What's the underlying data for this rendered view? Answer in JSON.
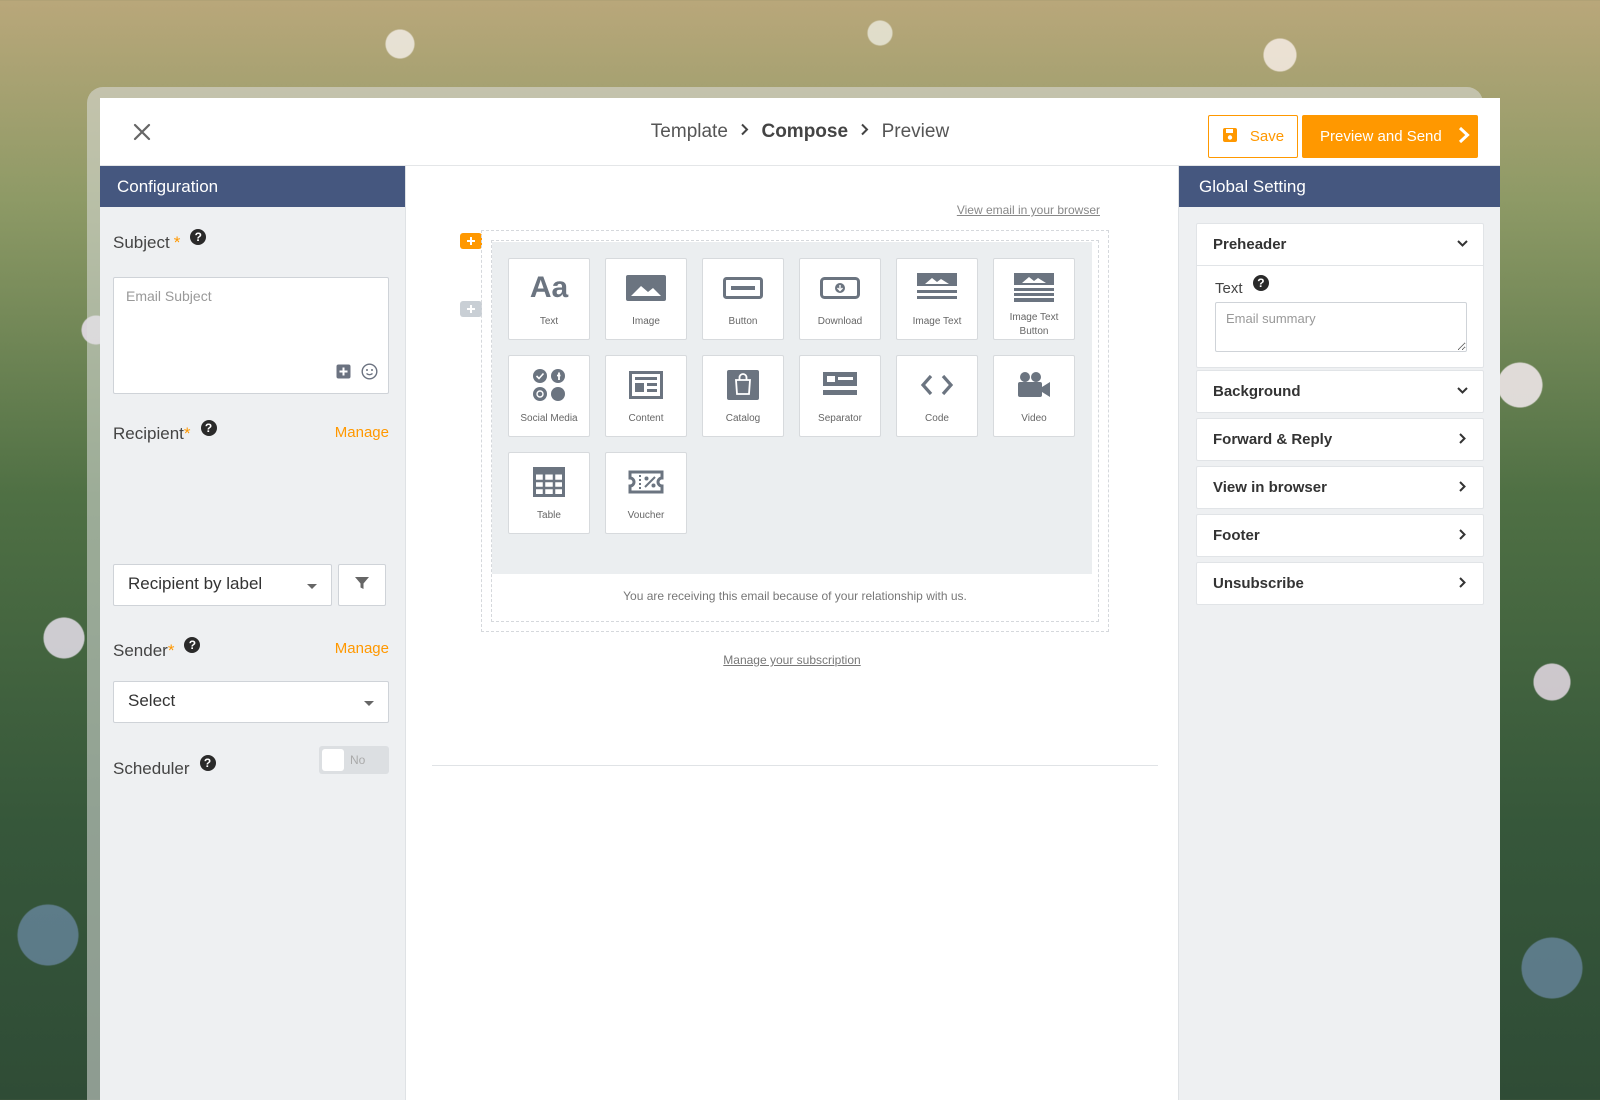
{
  "header": {
    "breadcrumb": [
      {
        "label": "Template"
      },
      {
        "label": "Compose"
      },
      {
        "label": "Preview"
      }
    ],
    "save_label": "Save",
    "send_label": "Preview and Send",
    "accent_color": "#ff9800"
  },
  "left": {
    "title": "Configuration",
    "subject_label": "Subject",
    "subject_required": "*",
    "subject_placeholder": "Email Subject",
    "recipient_label": "Recipient",
    "recipient_required": "*",
    "recipient_manage": "Manage",
    "recipient_value": "Recipient by label",
    "sender_label": "Sender",
    "sender_required": "*",
    "sender_manage": "Manage",
    "sender_value": "Select",
    "scheduler_label": "Scheduler",
    "scheduler_toggle": "No",
    "help_glyph": "?",
    "header_color": "#45577f"
  },
  "center": {
    "view_in_browser": "View email in your browser",
    "blocks": [
      {
        "label": "Text",
        "icon": "text-icon"
      },
      {
        "label": "Image",
        "icon": "image-icon"
      },
      {
        "label": "Button",
        "icon": "button-icon"
      },
      {
        "label": "Download",
        "icon": "download-icon"
      },
      {
        "label": "Image Text",
        "icon": "image-text-icon"
      },
      {
        "label": "Image Text Button",
        "icon": "image-text-button-icon"
      },
      {
        "label": "Social Media",
        "icon": "social-media-icon"
      },
      {
        "label": "Content",
        "icon": "content-icon"
      },
      {
        "label": "Catalog",
        "icon": "catalog-icon"
      },
      {
        "label": "Separator",
        "icon": "separator-icon"
      },
      {
        "label": "Code",
        "icon": "code-icon"
      },
      {
        "label": "Video",
        "icon": "video-icon"
      },
      {
        "label": "Table",
        "icon": "table-icon"
      },
      {
        "label": "Voucher",
        "icon": "voucher-icon"
      }
    ],
    "receiving_text": "You are receiving this email because of your relationship with us.",
    "manage_subscription": "Manage your subscription",
    "text_block_glyph": "Aa"
  },
  "right": {
    "title": "Global Setting",
    "sections": [
      {
        "label": "Preheader",
        "state": "expanded"
      },
      {
        "label": "Background",
        "state": "collapsed"
      },
      {
        "label": "Forward & Reply",
        "state": "collapsed"
      },
      {
        "label": "View in browser",
        "state": "collapsed"
      },
      {
        "label": "Footer",
        "state": "collapsed"
      },
      {
        "label": "Unsubscribe",
        "state": "collapsed"
      }
    ],
    "preheader_text_label": "Text",
    "preheader_placeholder": "Email summary"
  }
}
